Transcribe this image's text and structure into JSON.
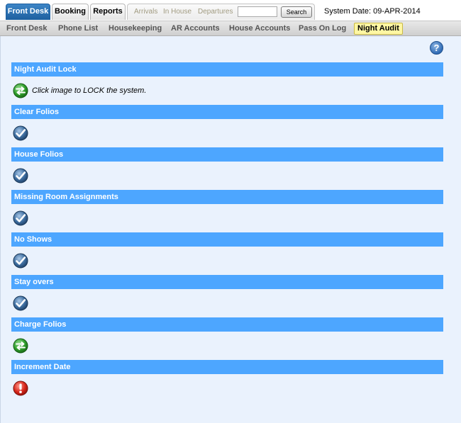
{
  "header": {
    "main_tabs": [
      {
        "label": "Front Desk",
        "active": true
      },
      {
        "label": "Booking",
        "active": false
      },
      {
        "label": "Reports",
        "active": false
      }
    ],
    "quick_links": [
      "Arrivals",
      "In House",
      "Departures"
    ],
    "search": {
      "value": "",
      "button_label": "Search"
    },
    "system_date": "System Date: 09-APR-2014"
  },
  "subnav": {
    "items": [
      {
        "label": "Front Desk",
        "active": false
      },
      {
        "label": "Phone List",
        "active": false
      },
      {
        "label": "Housekeeping",
        "active": false
      },
      {
        "label": "AR Accounts",
        "active": false
      },
      {
        "label": "House Accounts",
        "active": false
      },
      {
        "label": "Pass On Log",
        "active": false
      },
      {
        "label": "Night Audit",
        "active": true
      }
    ]
  },
  "help": {
    "icon": "help-icon"
  },
  "sections": [
    {
      "title": "Night Audit Lock",
      "status": "arrows",
      "hint": "Click image to LOCK the system."
    },
    {
      "title": "Clear Folios",
      "status": "check"
    },
    {
      "title": "House Folios",
      "status": "check"
    },
    {
      "title": "Missing Room Assignments",
      "status": "check"
    },
    {
      "title": "No Shows",
      "status": "check"
    },
    {
      "title": "Stay overs",
      "status": "check"
    },
    {
      "title": "Charge Folios",
      "status": "arrows"
    },
    {
      "title": "Increment Date",
      "status": "error"
    }
  ],
  "colors": {
    "section_header": "#4da6ff",
    "content_bg": "#eaf2fd",
    "active_tab": "#1d5f9f",
    "active_subnav": "#fff7a3"
  }
}
